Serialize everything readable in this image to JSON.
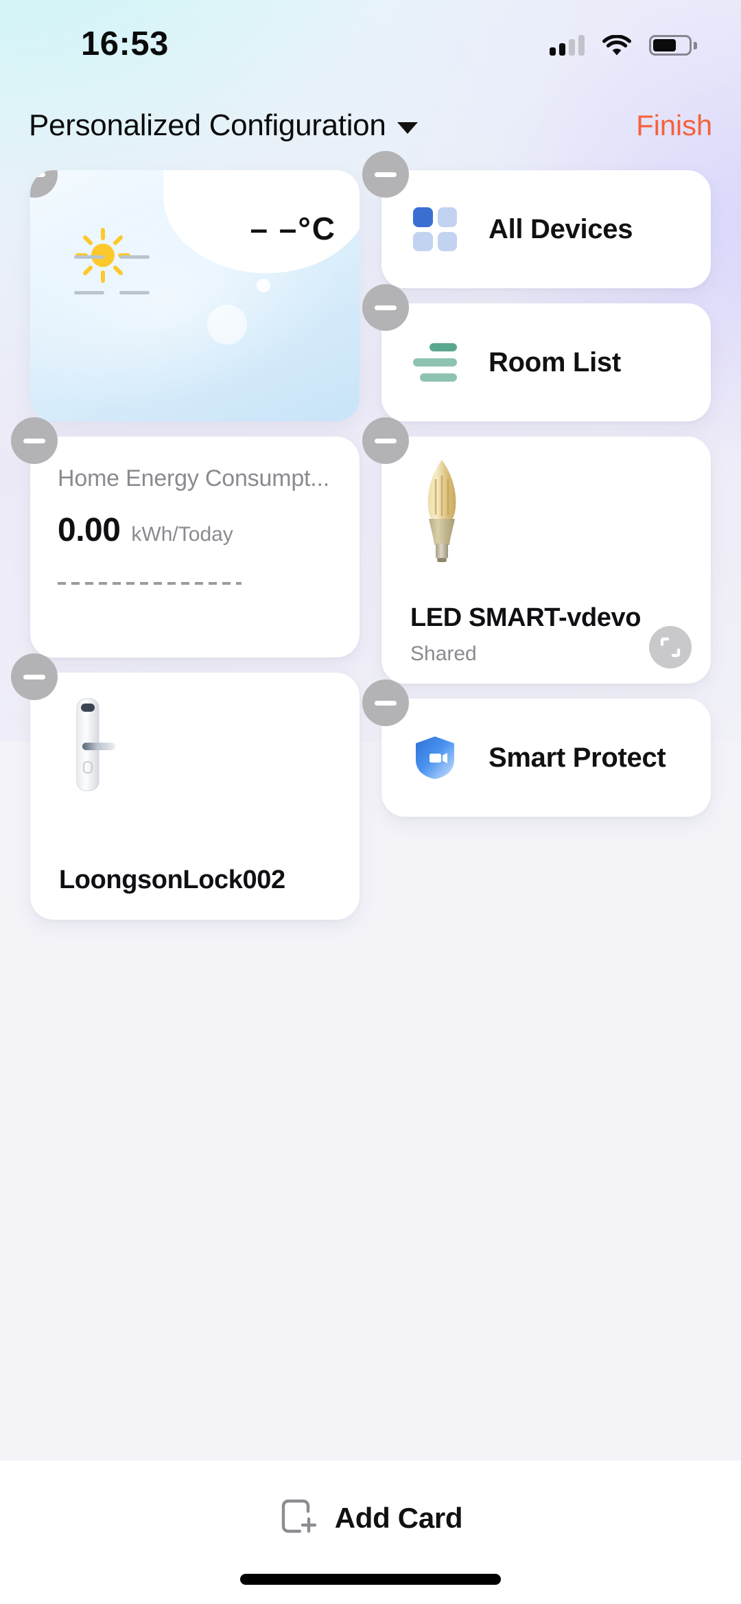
{
  "status_bar": {
    "time": "16:53",
    "signal_icon": "cellular-signal-icon",
    "signal_bars_filled": 2,
    "signal_bars_total": 4,
    "wifi_icon": "wifi-icon",
    "battery_icon": "battery-icon",
    "battery_level_percent": 65
  },
  "header": {
    "title": "Personalized Configuration",
    "dropdown_icon": "chevron-down-icon",
    "finish_label": "Finish",
    "finish_color": "#f5623c"
  },
  "cards": {
    "weather": {
      "name": "weather-card",
      "condition_icon": "sun-icon",
      "temperature": "– –°C",
      "remove_icon": "minus-icon"
    },
    "all_devices": {
      "name": "all-devices-card",
      "label": "All Devices",
      "icon": "grid-four-squares-icon",
      "icon_active_color": "#3a6fd1",
      "icon_inactive_color": "#c1d3f0",
      "remove_icon": "minus-icon"
    },
    "room_list": {
      "name": "room-list-card",
      "label": "Room List",
      "icon": "list-lines-icon",
      "icon_color": "#8ec2b1",
      "icon_accent_color": "#5aa790",
      "remove_icon": "minus-icon"
    },
    "energy": {
      "name": "home-energy-consumption-card",
      "title": "Home Energy Consumpt...",
      "value": "0.00",
      "unit": "kWh/Today",
      "remove_icon": "minus-icon"
    },
    "led_bulb": {
      "name": "led-smart-vdevo-card",
      "device_name": "LED SMART-vdevo",
      "status": "Shared",
      "icon": "candle-bulb-icon",
      "resize_icon": "resize-handle-icon",
      "remove_icon": "minus-icon"
    },
    "lock": {
      "name": "loongson-lock-card",
      "device_name": "LoongsonLock002",
      "icon": "smart-door-lock-icon",
      "remove_icon": "minus-icon"
    },
    "smart_protect": {
      "name": "smart-protect-card",
      "label": "Smart Protect",
      "icon": "shield-camera-icon",
      "icon_color": "#3d8ef0",
      "remove_icon": "minus-icon"
    }
  },
  "bottom_bar": {
    "add_card_label": "Add Card",
    "add_card_icon": "add-card-icon",
    "home_indicator": "home-indicator"
  }
}
